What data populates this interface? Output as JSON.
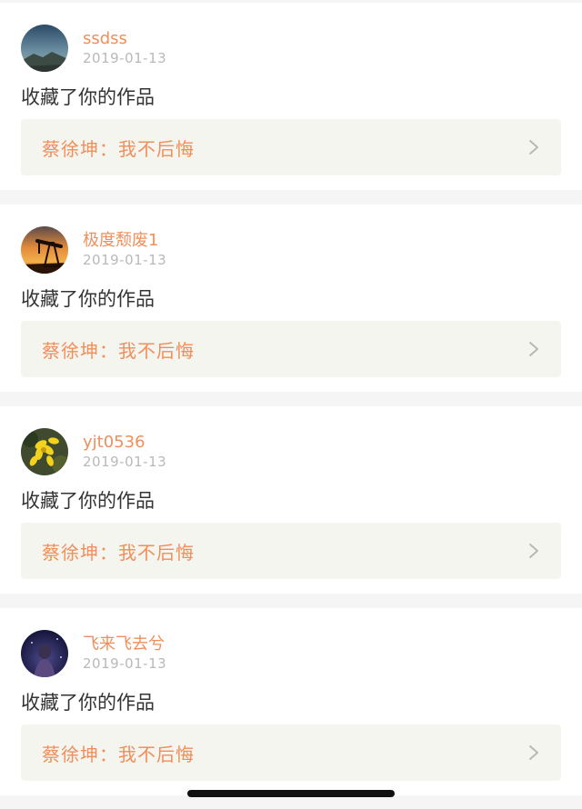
{
  "notifications": [
    {
      "avatar": "avatar-mountain-sky",
      "username": "ssdss",
      "date": "2019-01-13",
      "action": "收藏了你的作品",
      "work_title": "蔡徐坤：我不后悔"
    },
    {
      "avatar": "avatar-sunset-oil-pump",
      "username": "极度颓废1",
      "date": "2019-01-13",
      "action": "收藏了你的作品",
      "work_title": "蔡徐坤：我不后悔"
    },
    {
      "avatar": "avatar-yellow-flowers",
      "username": "yjt0536",
      "date": "2019-01-13",
      "action": "收藏了你的作品",
      "work_title": "蔡徐坤：我不后悔"
    },
    {
      "avatar": "avatar-dark-figure",
      "username": "飞来飞去兮",
      "date": "2019-01-13",
      "action": "收藏了你的作品",
      "work_title": "蔡徐坤：我不后悔"
    }
  ],
  "colors": {
    "accent": "#ef8f5c",
    "date_gray": "#b9b9b9",
    "work_box_bg": "#f5f5ef",
    "page_bg": "#f5f5f5"
  }
}
